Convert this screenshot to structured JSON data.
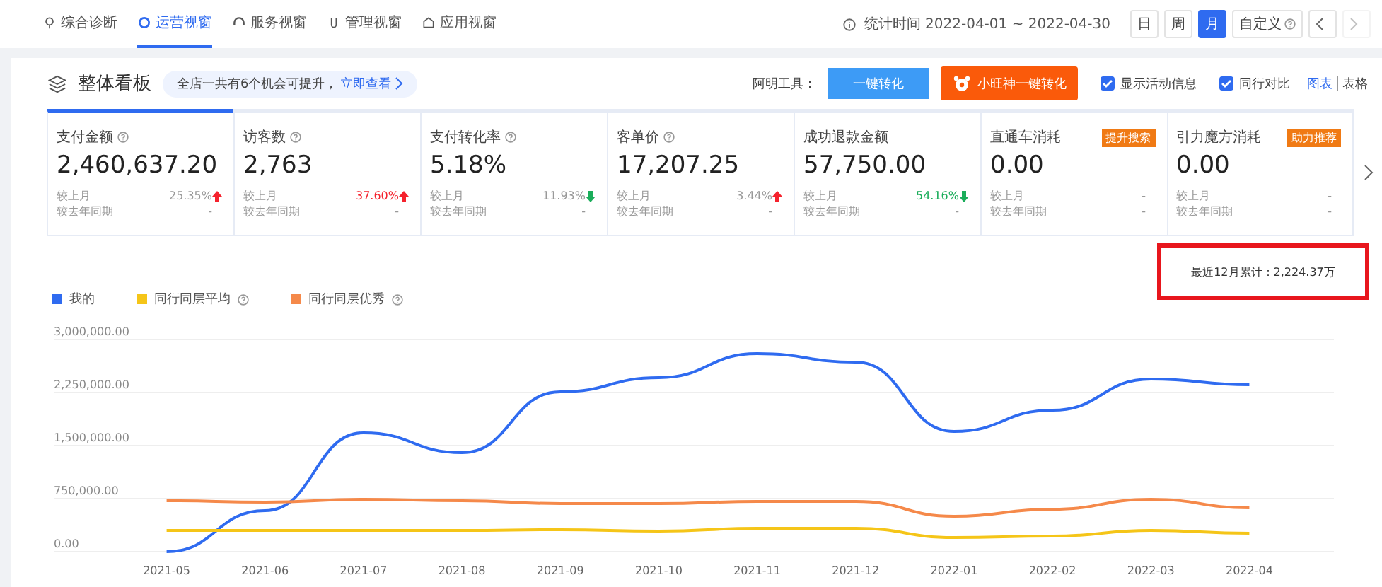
{
  "nav": {
    "tabs": [
      {
        "label": "综合诊断",
        "selected": false
      },
      {
        "label": "运营视窗",
        "selected": true
      },
      {
        "label": "服务视窗",
        "selected": false
      },
      {
        "label": "管理视窗",
        "selected": false
      },
      {
        "label": "应用视窗",
        "selected": false
      }
    ],
    "stat_time": "统计时间 2022-04-01 ~ 2022-04-30",
    "periods": [
      {
        "label": "日",
        "selected": false
      },
      {
        "label": "周",
        "selected": false
      },
      {
        "label": "月",
        "selected": true
      },
      {
        "label": "自定义",
        "selected": false
      }
    ],
    "prev_disabled": false,
    "next_disabled": true
  },
  "panel": {
    "title": "整体看板",
    "notice": "全店一共有6个机会可提升，",
    "notice_link": "立即查看",
    "tool_label": "阿明工具：",
    "tool_buttons": [
      {
        "label": "一键转化",
        "kind": "plain"
      },
      {
        "label": "小旺神一键转化",
        "kind": "mascot"
      }
    ],
    "options": [
      {
        "label": "显示活动信息",
        "checked": true
      },
      {
        "label": "同行对比",
        "checked": true
      }
    ],
    "views": [
      {
        "label": "图表",
        "selected": true
      },
      {
        "label": "表格",
        "selected": false
      }
    ]
  },
  "metrics": [
    {
      "title": "支付金额",
      "help": true,
      "value": "2,460,637.20",
      "selected": true,
      "compare": [
        {
          "label": "较上月",
          "value": "25.35%",
          "rising": true,
          "emphasized": false
        },
        {
          "label": "较去年同期",
          "value": "-"
        }
      ]
    },
    {
      "title": "访客数",
      "help": true,
      "value": "2,763",
      "selected": false,
      "compare": [
        {
          "label": "较上月",
          "value": "37.60%",
          "rising": true,
          "emphasized": true
        },
        {
          "label": "较去年同期",
          "value": "-"
        }
      ]
    },
    {
      "title": "支付转化率",
      "help": true,
      "value": "5.18%",
      "selected": false,
      "compare": [
        {
          "label": "较上月",
          "value": "11.93%",
          "rising": false,
          "emphasized": false
        },
        {
          "label": "较去年同期",
          "value": "-"
        }
      ]
    },
    {
      "title": "客单价",
      "help": true,
      "value": "17,207.25",
      "selected": false,
      "compare": [
        {
          "label": "较上月",
          "value": "3.44%",
          "rising": true,
          "emphasized": false
        },
        {
          "label": "较去年同期",
          "value": "-"
        }
      ]
    },
    {
      "title": "成功退款金额",
      "help": false,
      "value": "57,750.00",
      "selected": false,
      "compare": [
        {
          "label": "较上月",
          "value": "54.16%",
          "rising": false,
          "emphasized": true
        },
        {
          "label": "较去年同期",
          "value": "-"
        }
      ]
    },
    {
      "title": "直通车消耗",
      "help": false,
      "tag": "提升搜索",
      "value": "0.00",
      "selected": false,
      "compare": [
        {
          "label": "较上月",
          "value": "-"
        },
        {
          "label": "较去年同期",
          "value": "-"
        }
      ]
    },
    {
      "title": "引力魔方消耗",
      "help": false,
      "tag": "助力推荐",
      "value": "0.00",
      "selected": false,
      "compare": [
        {
          "label": "较上月",
          "value": "-"
        },
        {
          "label": "较去年同期",
          "value": "-"
        }
      ]
    }
  ],
  "summary": {
    "text": "最近12月累计：2,224.37万",
    "highlighted": true
  },
  "legend": [
    {
      "help": false
    },
    {
      "help": true
    },
    {
      "help": true
    }
  ],
  "chart_data": {
    "type": "line",
    "grid": true,
    "categories": [
      "2021-05",
      "2021-06",
      "2021-07",
      "2021-08",
      "2021-09",
      "2021-10",
      "2021-11",
      "2021-12",
      "2022-01",
      "2022-02",
      "2022-03",
      "2022-04"
    ],
    "ylim": [
      0,
      3000000
    ],
    "yticks": [
      {
        "value": 0,
        "label": "0.00"
      },
      {
        "value": 750000,
        "label": "750,000.00"
      },
      {
        "value": 1500000,
        "label": "1,500,000.00"
      },
      {
        "value": 2250000,
        "label": "2,250,000.00"
      },
      {
        "value": 3000000,
        "label": "3,000,000.00"
      }
    ],
    "series": [
      {
        "name": "我的",
        "color": "#2f6bf0",
        "values": [
          0,
          580000,
          1680000,
          1400000,
          2260000,
          2460000,
          2800000,
          2680000,
          1700000,
          2000000,
          2440000,
          2360000
        ]
      },
      {
        "name": "同行同层平均",
        "color": "#f5c518",
        "values": [
          300000,
          300000,
          300000,
          300000,
          310000,
          290000,
          330000,
          330000,
          200000,
          220000,
          300000,
          260000
        ]
      },
      {
        "name": "同行同层优秀",
        "color": "#f5894a",
        "values": [
          720000,
          700000,
          740000,
          720000,
          680000,
          680000,
          710000,
          710000,
          500000,
          600000,
          740000,
          620000
        ]
      }
    ]
  }
}
